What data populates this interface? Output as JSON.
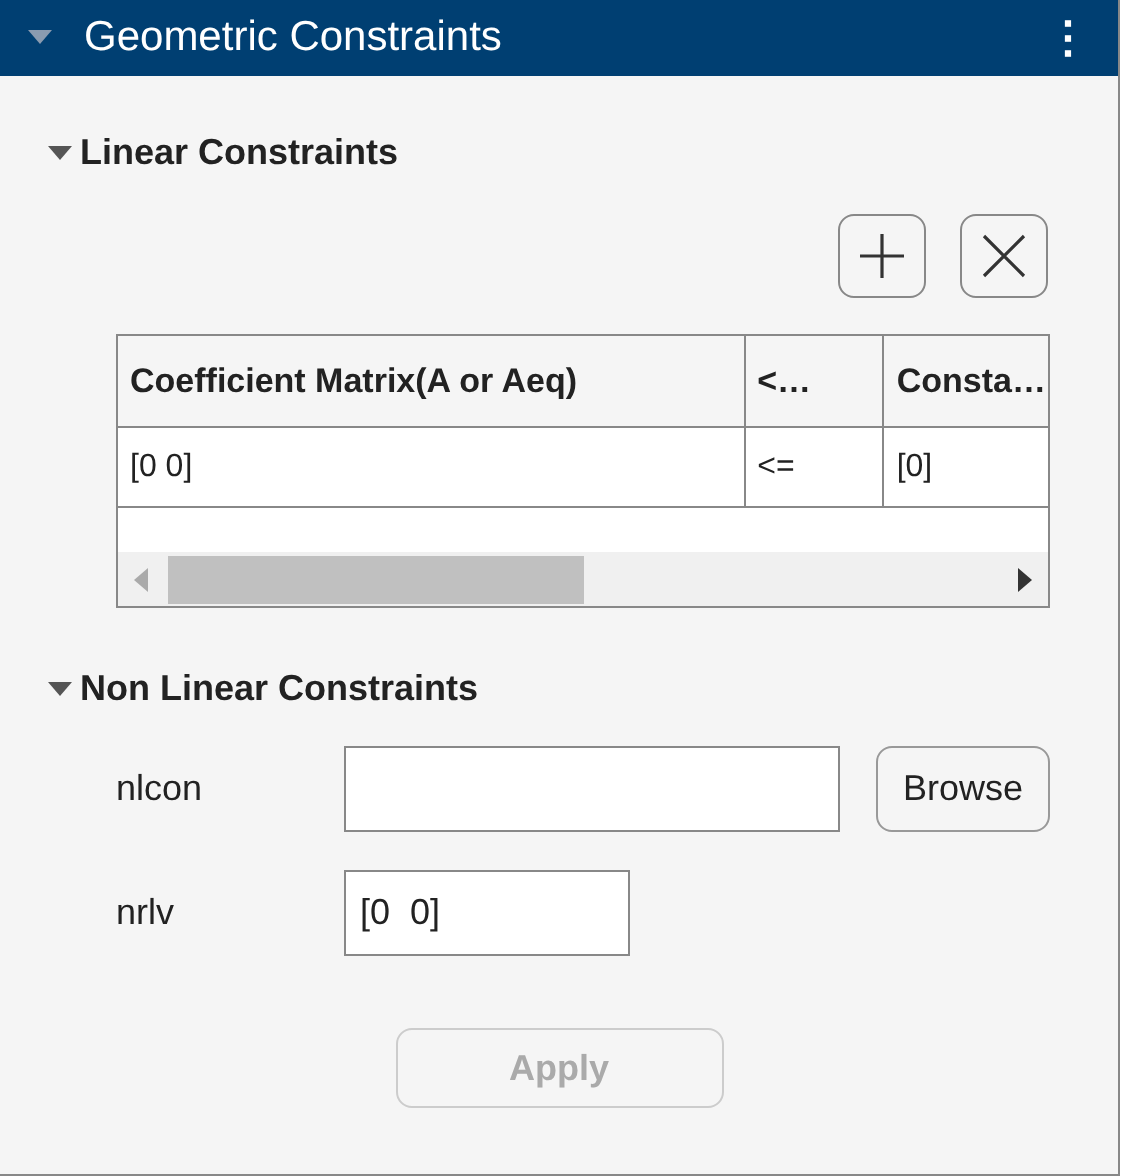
{
  "header": {
    "title": "Geometric Constraints",
    "expanded": true,
    "menu_icon": "⋮"
  },
  "linear": {
    "title": "Linear Constraints",
    "expanded": true,
    "table": {
      "columns": [
        "Coefficient Matrix(A or Aeq)",
        "<…",
        "Consta…"
      ],
      "rows": [
        [
          "[0 0]",
          "<=",
          "[0]"
        ]
      ]
    }
  },
  "nonlinear": {
    "title": "Non Linear Constraints",
    "expanded": true,
    "fields": [
      {
        "label": "nlcon",
        "button": "Browse"
      },
      {
        "label": "nrlv",
        "value": "[0  0]"
      }
    ]
  },
  "apply": {
    "label": "Apply",
    "disabled": true
  }
}
